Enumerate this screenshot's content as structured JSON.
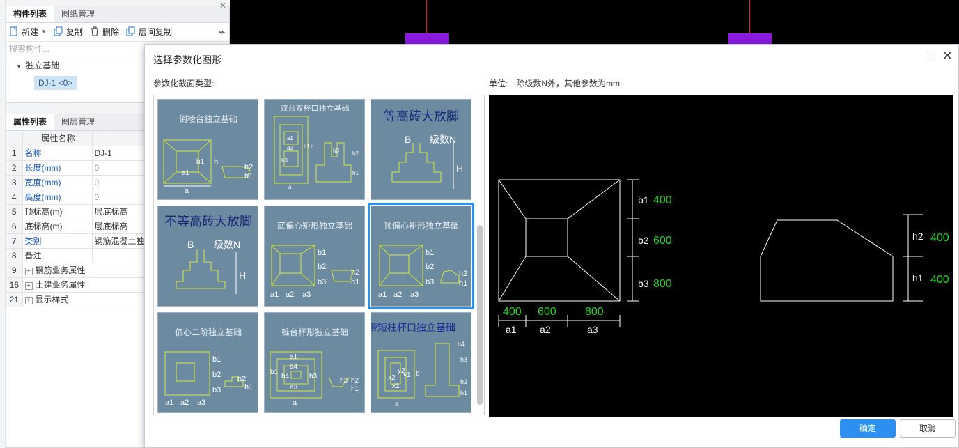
{
  "left_panel": {
    "component_tabs": [
      "构件列表",
      "图纸管理"
    ],
    "toolbar": {
      "new": "新建",
      "copy": "复制",
      "delete": "删除",
      "floor_copy": "层间复制"
    },
    "search_placeholder": "搜索构件...",
    "tree": {
      "group": "独立基础",
      "item": "DJ-1 <0>"
    },
    "prop_tabs": [
      "属性列表",
      "图层管理"
    ],
    "prop_headers": {
      "name": "属性名称",
      "value": "属性"
    },
    "props": [
      {
        "num": "1",
        "name": "名称",
        "value": "DJ-1"
      },
      {
        "num": "2",
        "name": "长度(mm)",
        "value": "0"
      },
      {
        "num": "3",
        "name": "宽度(mm)",
        "value": "0"
      },
      {
        "num": "4",
        "name": "高度(mm)",
        "value": "0"
      },
      {
        "num": "5",
        "name": "顶标高(m)",
        "value": "层底标高"
      },
      {
        "num": "6",
        "name": "底标高(m)",
        "value": "层底标高"
      },
      {
        "num": "7",
        "name": "类别",
        "value": "钢筋混凝土独"
      },
      {
        "num": "8",
        "name": "备注",
        "value": ""
      },
      {
        "num": "9",
        "name": "钢筋业务属性",
        "value": ""
      },
      {
        "num": "16",
        "name": "土建业务属性",
        "value": ""
      },
      {
        "num": "21",
        "name": "显示样式",
        "value": ""
      }
    ]
  },
  "dialog": {
    "title": "选择参数化图形",
    "section_type_label": "参数化截面类型:",
    "unit_label": "单位:",
    "unit_value": "除级数N外，其他参数为mm",
    "gallery": [
      {
        "title": "倒棱台独立基础",
        "labels": [
          "b1",
          "b",
          "a1",
          "a",
          "h2",
          "h1"
        ]
      },
      {
        "title": "双台双杯口独立基础",
        "labels": [
          "a",
          "b",
          "a1",
          "b1",
          "h1",
          "h2",
          "h3",
          "a3",
          "b3"
        ]
      },
      {
        "title": "等高砖大放脚",
        "labels": [
          "B",
          "级数N",
          "H"
        ]
      },
      {
        "title": "不等高砖大放脚",
        "labels": [
          "B",
          "级数N",
          "H"
        ]
      },
      {
        "title": "底偏心矩形独立基础",
        "labels": [
          "b1",
          "b2",
          "b3",
          "a1",
          "a2",
          "a3",
          "h1",
          "h2"
        ]
      },
      {
        "title": "顶偏心矩形独立基础",
        "labels": [
          "b1",
          "b2",
          "b3",
          "a1",
          "a2",
          "a3",
          "h2",
          "h1"
        ]
      },
      {
        "title": "偏心二阶独立基础",
        "labels": [
          "b1",
          "b2",
          "b3",
          "a1",
          "a2",
          "a3",
          "h2",
          "h1"
        ]
      },
      {
        "title": "锥台杯形独立基础",
        "labels": [
          "a1",
          "a4",
          "b1",
          "b4",
          "b3",
          "a3",
          "a",
          "h3",
          "h2",
          "h1"
        ]
      },
      {
        "title": "带短柱杯口独立基础",
        "labels": [
          "x2",
          "x1",
          "y2",
          "y1",
          "b",
          "a",
          "h4",
          "h3",
          "h2",
          "h1"
        ]
      }
    ],
    "selected_index": 5,
    "preview": {
      "plan_dims": {
        "b1": "400",
        "b2": "600",
        "b3": "800",
        "a1": "400",
        "a2": "600",
        "a3": "800"
      },
      "plan_labels": [
        "b1",
        "b2",
        "b3",
        "a1",
        "a2",
        "a3"
      ],
      "section_dims": {
        "h2": "400",
        "h1": "400"
      },
      "section_labels": [
        "h2",
        "h1"
      ]
    },
    "ok_label": "确定",
    "cancel_label": "取消"
  },
  "colors": {
    "accent": "#2d8ff0",
    "dim_value": "#22d322",
    "thumb_bg": "#6c8aa0"
  }
}
